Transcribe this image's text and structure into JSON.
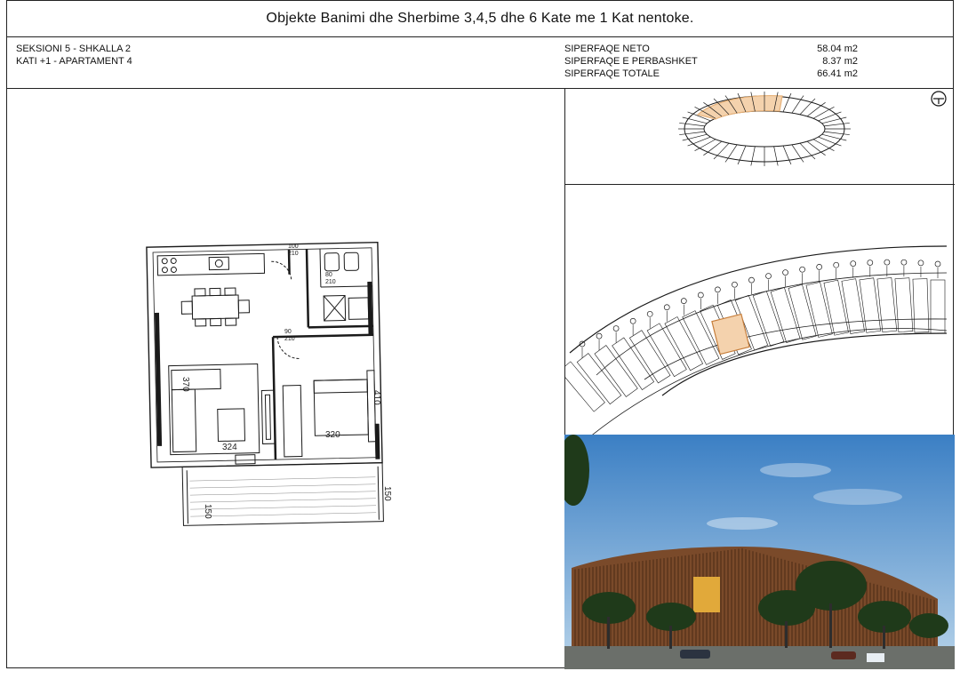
{
  "header": {
    "title": "Objekte Banimi dhe Sherbime 3,4,5 dhe 6 Kate me 1 Kat nentoke."
  },
  "unit": {
    "section_line": "SEKSIONI 5 - SHKALLA 2",
    "floor_line": "KATI +1 - APARTAMENT 4"
  },
  "areas": [
    {
      "label": "SIPERFAQE NETO",
      "value": "58.04 m2"
    },
    {
      "label": "SIPERFAQE E PERBASHKET",
      "value": "8.37 m2"
    },
    {
      "label": "SIPERFAQE TOTALE",
      "value": "66.41 m2"
    }
  ],
  "plan": {
    "dimensions": {
      "living_height": "370",
      "living_width": "324",
      "bedroom_width": "320",
      "bedroom_height": "410",
      "balcony_left": "150",
      "balcony_right": "150"
    },
    "door_tags": [
      {
        "top": "100",
        "bottom": "210"
      },
      {
        "top": "80",
        "bottom": "210"
      },
      {
        "top": "90",
        "bottom": "210"
      }
    ]
  },
  "colors": {
    "line": "#1a1a1a",
    "highlight": "#e7b27a",
    "highlight_fill": "#f4d2ad",
    "sky_top": "#3b7fc4",
    "sky_bottom": "#b8d4ea",
    "facade": "#7a4a2a"
  },
  "icons": {
    "north_arrow": "north-arrow-icon"
  }
}
